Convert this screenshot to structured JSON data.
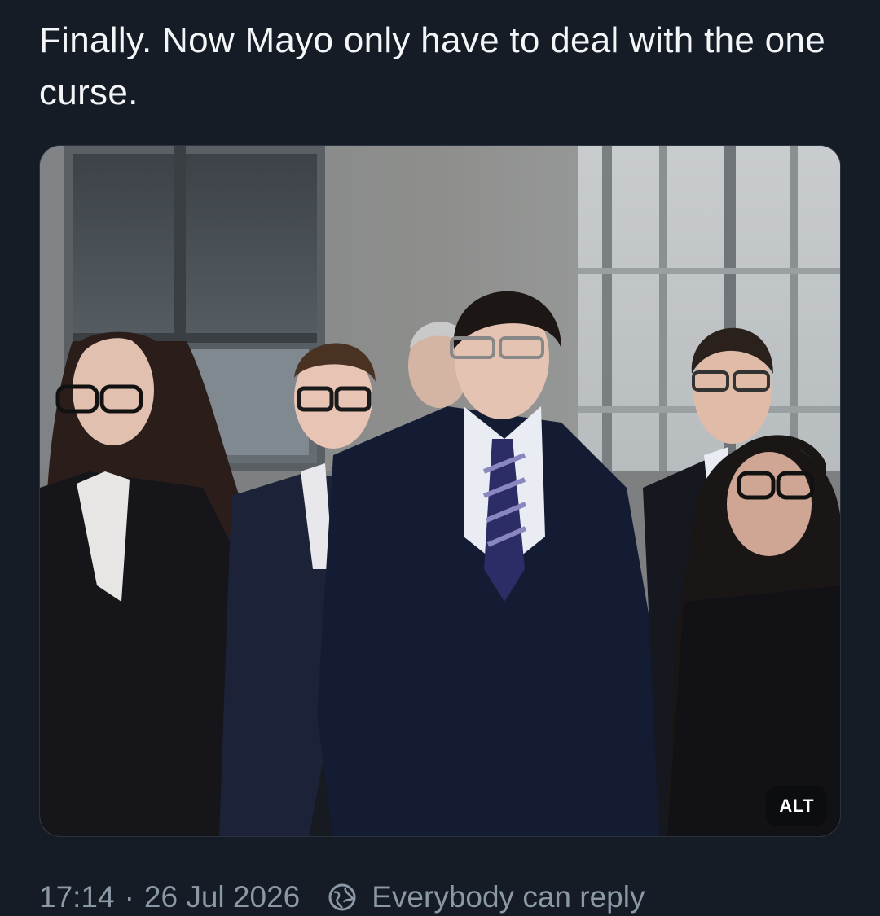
{
  "post": {
    "text": "Finally. Now Mayo only have to deal with the one curse.",
    "time": "17:14",
    "separator": "·",
    "date": "26 Jul 2026",
    "reply_setting": "Everybody can reply",
    "reply_icon": "globe-icon"
  },
  "media": {
    "alt_label": "ALT"
  },
  "colors": {
    "background": "#151c26",
    "text": "#f3f5f7",
    "meta": "#8b98a5"
  }
}
